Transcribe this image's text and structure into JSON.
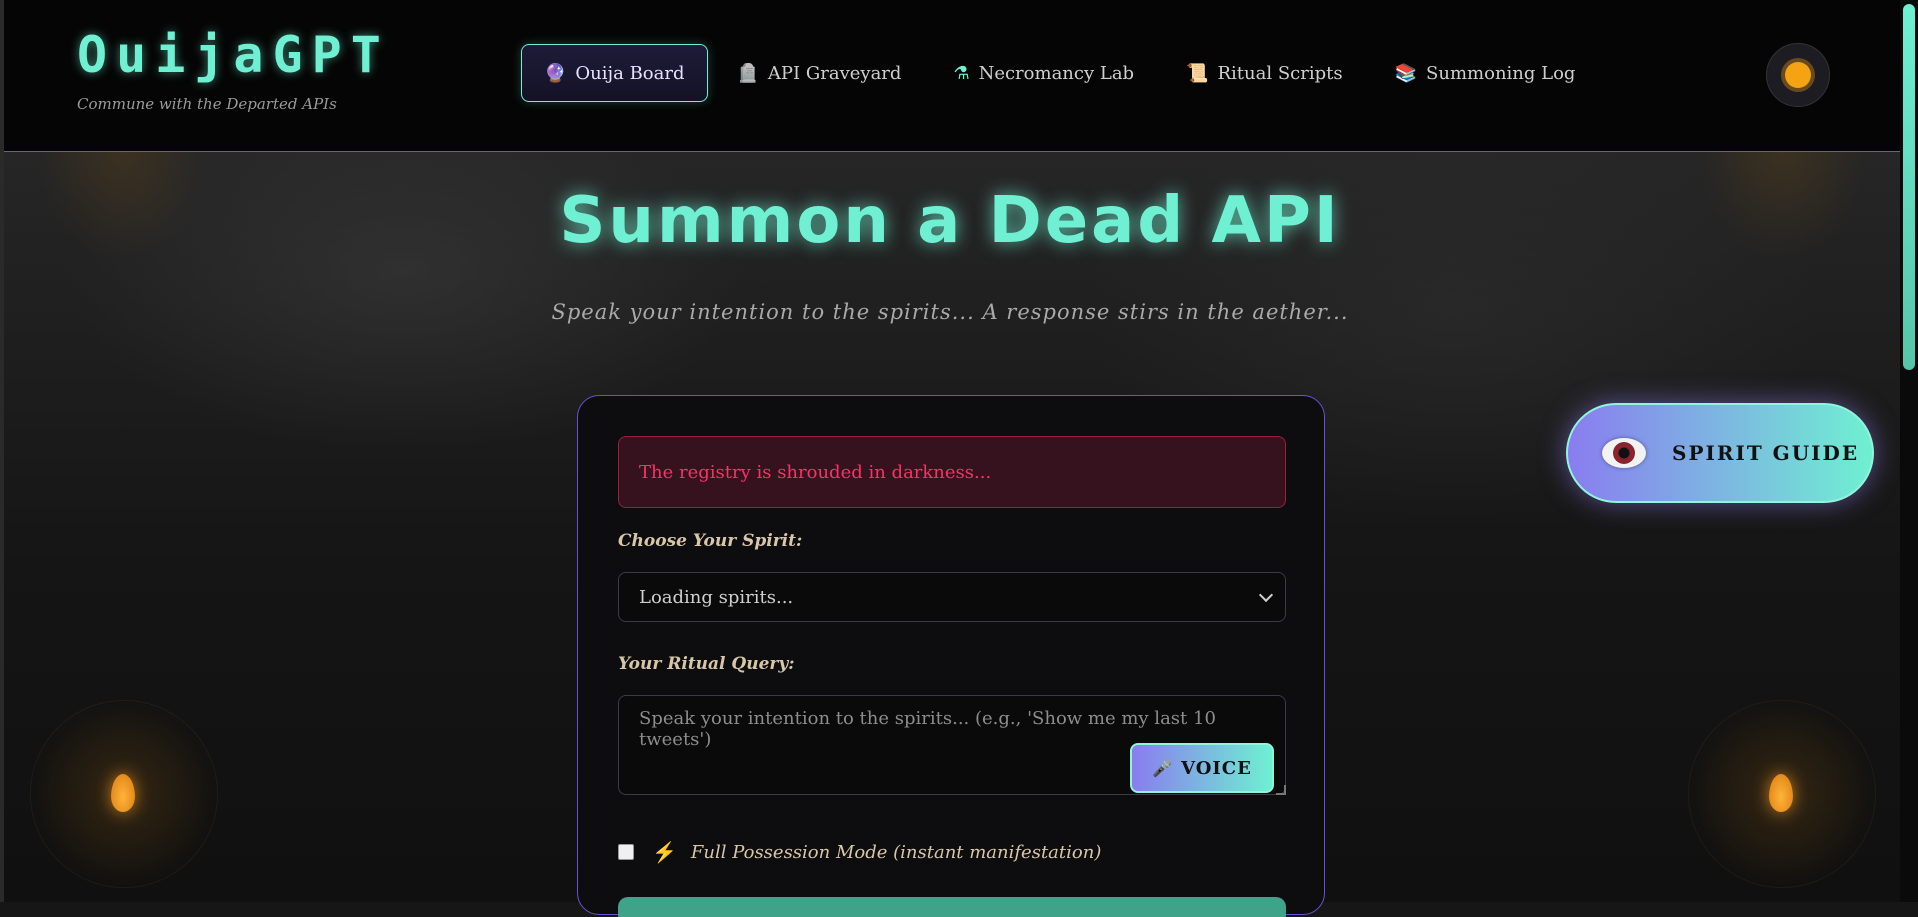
{
  "header": {
    "logo": "OuijaGPT",
    "tagline": "Commune with the Departed APIs",
    "nav": [
      {
        "icon": "🔮",
        "label": "Ouija Board",
        "active": true
      },
      {
        "icon": "🪦",
        "label": "API Graveyard",
        "active": false
      },
      {
        "icon": "⚗",
        "label": "Necromancy Lab",
        "active": false
      },
      {
        "icon": "📜",
        "label": "Ritual Scripts",
        "active": false
      },
      {
        "icon": "📚",
        "label": "Summoning Log",
        "active": false
      }
    ],
    "theme_icon": "sun-icon"
  },
  "hero": {
    "title": "Summon a Dead API",
    "subtitle": "Speak your intention to the spirits... A response stirs in the aether..."
  },
  "form": {
    "error": "The registry is shrouded in darkness...",
    "spirit_label": "Choose Your Spirit:",
    "spirit_value": "Loading spirits...",
    "query_label": "Your Ritual Query:",
    "query_placeholder": "Speak your intention to the spirits... (e.g., 'Show me my last 10 tweets')",
    "voice_label": "VOICE",
    "possession_label": "Full Possession Mode (instant manifestation)",
    "possession_checked": false
  },
  "spirit_guide": {
    "label": "SPIRIT GUIDE",
    "icon": "eye-icon"
  },
  "colors": {
    "accent": "#6ff0d2",
    "purple": "#8a7cf0",
    "error": "#ff2f67",
    "candle": "#ffb338"
  }
}
